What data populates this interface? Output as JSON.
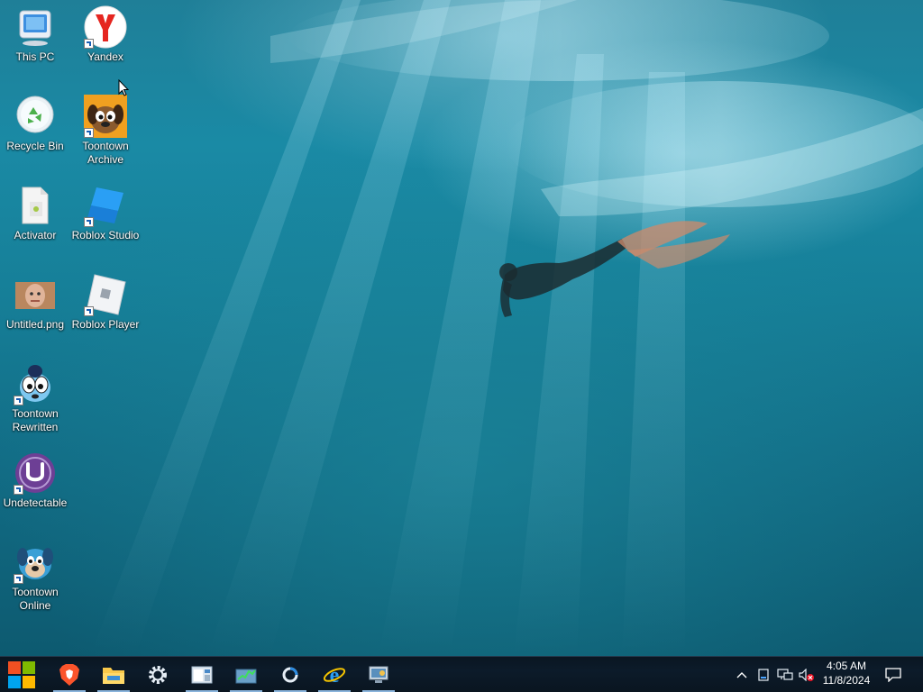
{
  "desktop": {
    "icons": [
      {
        "label": "This PC",
        "icon": "this-pc-icon",
        "shortcut": false
      },
      {
        "label": "Yandex",
        "icon": "yandex-browser-icon",
        "shortcut": true
      },
      {
        "label": "Recycle Bin",
        "icon": "recycle-bin-icon",
        "shortcut": false
      },
      {
        "label": "Toontown Archive",
        "icon": "toontown-archive-icon",
        "shortcut": true
      },
      {
        "label": "Activator",
        "icon": "activator-file-icon",
        "shortcut": false
      },
      {
        "label": "Roblox Studio",
        "icon": "roblox-studio-icon",
        "shortcut": true
      },
      {
        "label": "Untitled.png",
        "icon": "image-thumbnail-icon",
        "shortcut": false
      },
      {
        "label": "Roblox Player",
        "icon": "roblox-player-icon",
        "shortcut": true
      },
      {
        "label": "Toontown Rewritten",
        "icon": "toontown-rewritten-icon",
        "shortcut": true
      },
      {
        "label": "Undetectable",
        "icon": "undetectable-icon",
        "shortcut": true
      },
      {
        "label": "Toontown Online",
        "icon": "toontown-online-icon",
        "shortcut": true
      }
    ]
  },
  "taskbar": {
    "start": {
      "icon": "windows-start-icon"
    },
    "pinned": [
      {
        "name": "brave-browser",
        "icon": "brave-icon",
        "open": true
      },
      {
        "name": "file-explorer",
        "icon": "folder-icon",
        "open": true
      },
      {
        "name": "settings",
        "icon": "gear-icon",
        "open": false
      },
      {
        "name": "app-window",
        "icon": "window-app-icon",
        "open": true
      },
      {
        "name": "task-manager",
        "icon": "task-manager-icon",
        "open": true
      },
      {
        "name": "cortana",
        "icon": "circle-ring-icon",
        "open": true
      },
      {
        "name": "internet-explorer",
        "icon": "internet-explorer-icon",
        "open": true
      },
      {
        "name": "control-panel",
        "icon": "control-panel-icon",
        "open": true
      }
    ],
    "tray": {
      "icons": [
        "chevron-up-icon",
        "removable-drive-icon",
        "network-icon",
        "volume-muted-icon"
      ],
      "time": "4:05 AM",
      "date": "11/8/2024",
      "notification_icon": "action-center-icon"
    }
  },
  "colors": {
    "taskbar": "#0c1b2a",
    "water_light": "#1a8aa5",
    "water_dark": "#0d5a70",
    "windows_logo_red": "#f25022",
    "roblox_blue": "#1e8ff0"
  }
}
